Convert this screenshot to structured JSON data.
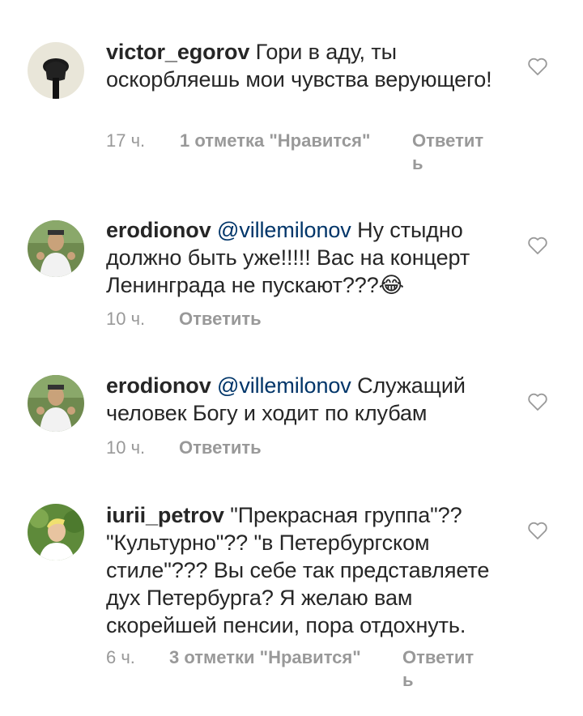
{
  "comments": [
    {
      "username": "victor_egorov",
      "mention": "",
      "text": "Гори в аду, ты оскорбляешь мои чувства верующего!",
      "time": "17 ч.",
      "likes": "1 отметка \"Нравится\"",
      "reply": "Ответить"
    },
    {
      "username": "erodionov",
      "mention": "@villemilonov",
      "text": "Ну стыдно должно быть уже!!!!! Вас на концерт Ленинграда не пускают???😂",
      "time": "10 ч.",
      "likes": "",
      "reply": "Ответить"
    },
    {
      "username": "erodionov",
      "mention": "@villemilonov",
      "text": "Служащий человек Богу и ходит по клубам",
      "time": "10 ч.",
      "likes": "",
      "reply": "Ответить"
    },
    {
      "username": "iurii_petrov",
      "mention": "",
      "text": "\"Прекрасная группа\"?? \"Культурно\"?? \"в Петербургском стиле\"??? Вы себе так представляете дух Петербурга? Я желаю вам скорейшей пенсии, пора отдохнуть.",
      "time": "6 ч.",
      "likes": "3 отметки \"Нравится\"",
      "reply": "Ответить"
    }
  ],
  "icons": {
    "like": "heart-outline-icon",
    "avatar": "user-avatar"
  },
  "colors": {
    "text": "#262626",
    "mention": "#003569",
    "meta": "#999999"
  }
}
